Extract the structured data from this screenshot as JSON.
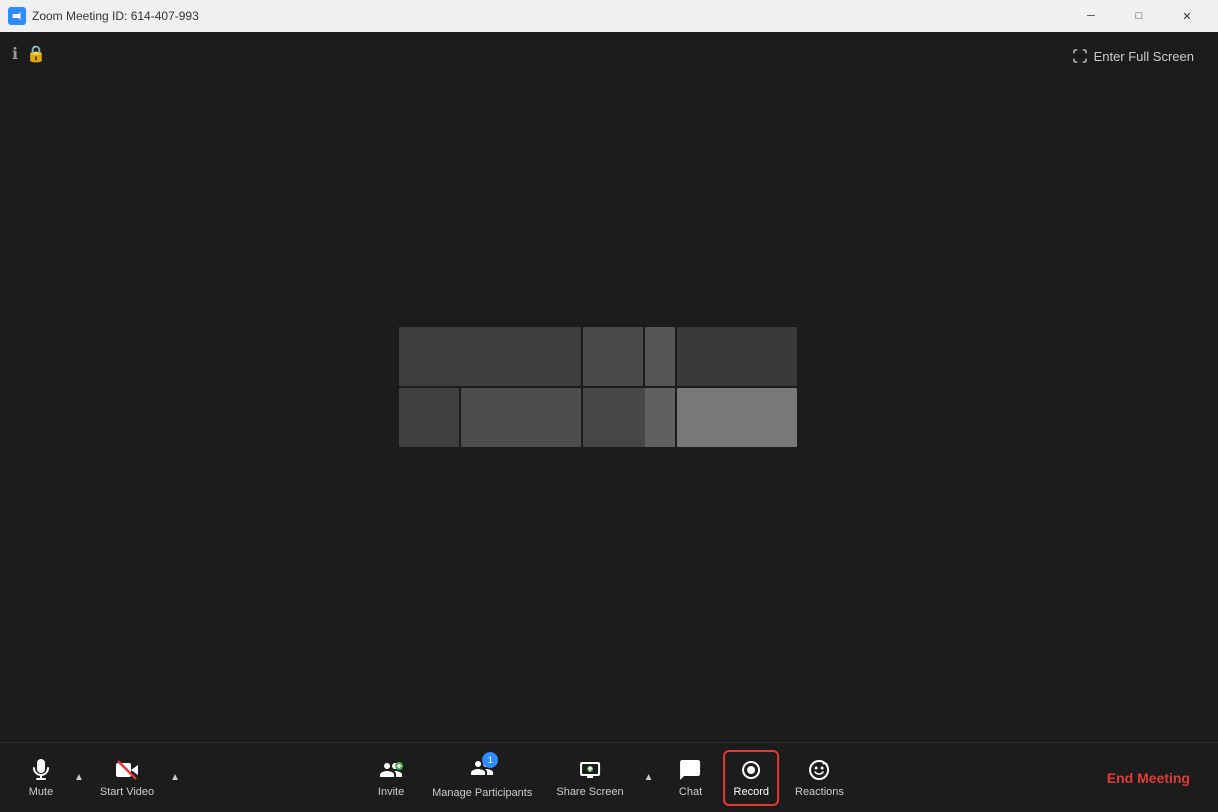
{
  "titleBar": {
    "title": "Zoom Meeting ID: 614-407-993",
    "minimizeLabel": "─",
    "maximizeLabel": "□",
    "closeLabel": "✕"
  },
  "header": {
    "fullscreenLabel": "Enter Full Screen"
  },
  "toolbar": {
    "mute": {
      "label": "Mute"
    },
    "startVideo": {
      "label": "Start Video"
    },
    "invite": {
      "label": "Invite"
    },
    "manageParticipants": {
      "label": "Manage Participants",
      "badge": "1"
    },
    "shareScreen": {
      "label": "Share Screen"
    },
    "chat": {
      "label": "Chat"
    },
    "record": {
      "label": "Record"
    },
    "reactions": {
      "label": "Reactions"
    },
    "endMeeting": {
      "label": "End Meeting"
    }
  }
}
